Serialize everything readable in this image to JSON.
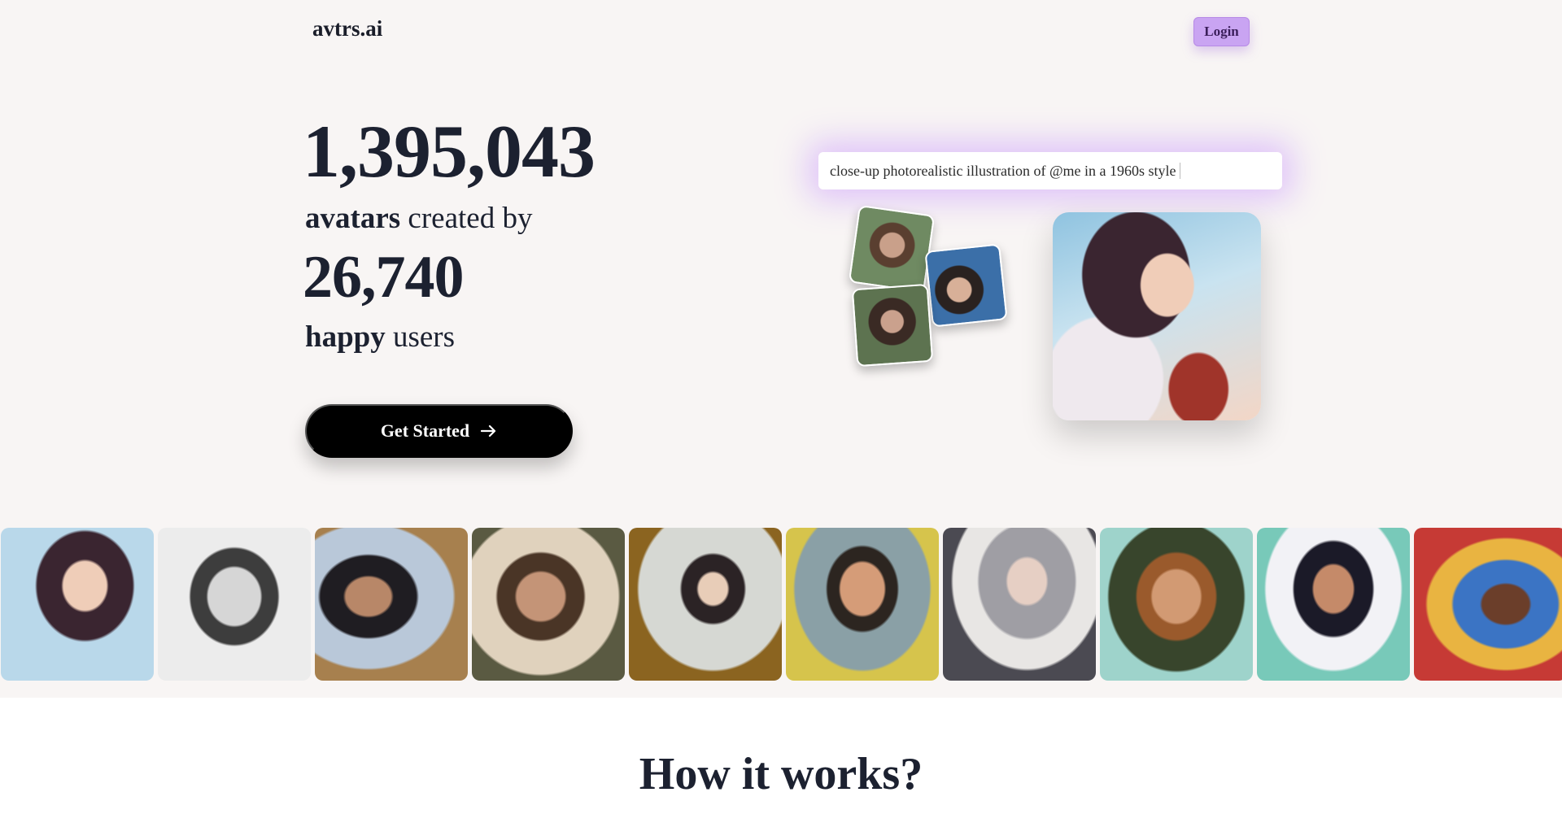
{
  "header": {
    "brand": "avtrs.ai",
    "login_label": "Login"
  },
  "hero": {
    "avatars_count": "1,395,043",
    "avatars_bold": "avatars",
    "avatars_rest": " created by",
    "users_count": "26,740",
    "users_bold": "happy",
    "users_rest": " users",
    "cta_label": "Get Started",
    "cta_icon": "arrow-right-icon"
  },
  "demo": {
    "prompt_text": "close-up photorealistic illustration of @me in a 1960s style",
    "input_photos": [
      "woman-photo-1",
      "woman-photo-2",
      "woman-photo-3"
    ],
    "result_avatar": "generated-avatar"
  },
  "gallery": {
    "items": [
      "anime-woman-fur-avatar",
      "pencil-sketch-man-avatar",
      "woman-with-camel-avatar",
      "bearded-man-with-camel-avatar",
      "framed-portrait-woman-avatar",
      "1960s-man-street-avatar",
      "silver-hair-woman-avatar",
      "cartoon-bearded-man-avatar",
      "girl-in-hoodie-avatar",
      "smiling-man-colorful-avatar"
    ]
  },
  "how_it_works": {
    "title": "How it works?"
  }
}
